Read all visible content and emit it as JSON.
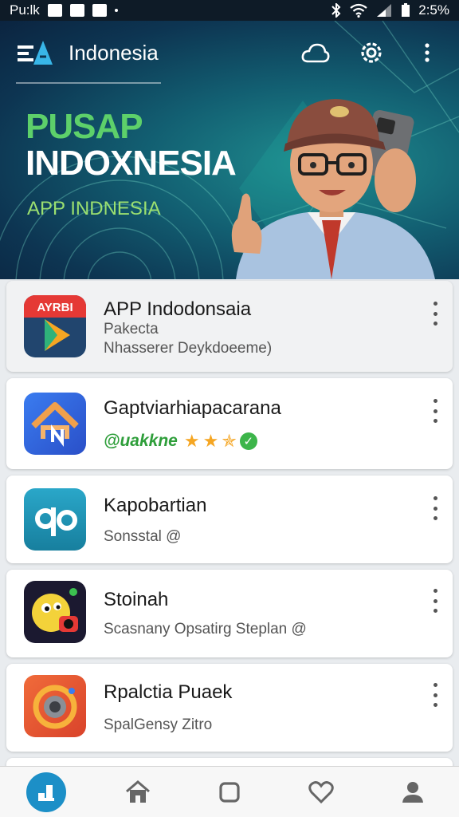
{
  "status_bar": {
    "carrier": "Pu:lk",
    "battery": "2:5%"
  },
  "app_bar": {
    "title": "Indonesia",
    "icons": [
      "cloud-icon",
      "settings-icon",
      "more-vert-icon"
    ]
  },
  "hero": {
    "title_line1": "PUSAP",
    "title_line2": "INDOXNESIA",
    "subtitle": "APP INDNESIA"
  },
  "apps": [
    {
      "name": "APP Indodonsaia",
      "line1": "Pakecta",
      "line2": "Nhasserer Deykdoeeme)"
    },
    {
      "name": "Gaptviarhiapacarana",
      "tag": "@uakkne"
    },
    {
      "name": "Kapobartian",
      "line1": "Sonsstal @"
    },
    {
      "name": "Stoinah",
      "line1": "Scasnany Opsatirg Steplan @"
    },
    {
      "name": "Rpalctia Puaek",
      "line1": "SpalGensy Zitro"
    }
  ],
  "bottom_nav": [
    "app-logo-icon",
    "home-icon",
    "square-icon",
    "heart-icon",
    "profile-icon"
  ],
  "colors": {
    "accent": "#1c8fc7",
    "hero_green": "#5dd06a",
    "star": "#f5a623"
  }
}
